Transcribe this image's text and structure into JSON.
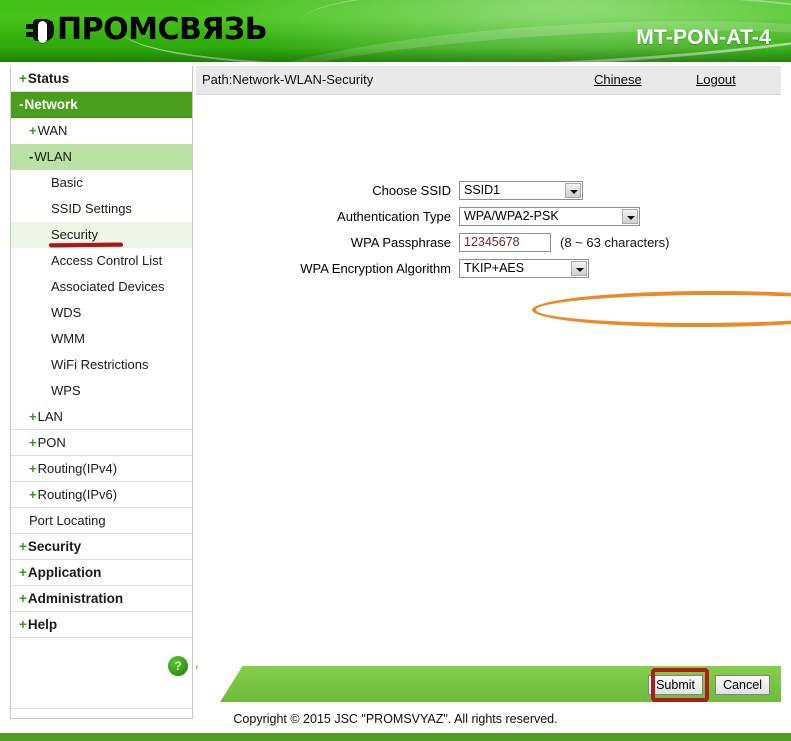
{
  "header": {
    "logo_text": "ПРОМСВЯЗЬ",
    "logo_icon": "plug-icon",
    "model": "MT-PON-AT-4",
    "brand_green": "#3fbf16"
  },
  "sidebar": {
    "items": [
      {
        "sign": "+",
        "label": "Status",
        "level": "top",
        "state": "normal"
      },
      {
        "sign": "-",
        "label": "Network",
        "level": "top",
        "state": "active-dark"
      },
      {
        "sign": "+",
        "label": "WAN",
        "level": "lvl2",
        "state": "normal"
      },
      {
        "sign": "-",
        "label": "WLAN",
        "level": "lvl2",
        "state": "active-mid"
      },
      {
        "sign": "",
        "label": "Basic",
        "level": "lvl3",
        "state": "normal"
      },
      {
        "sign": "",
        "label": "SSID Settings",
        "level": "lvl3",
        "state": "normal"
      },
      {
        "sign": "",
        "label": "Security",
        "level": "lvl3",
        "state": "active-pale"
      },
      {
        "sign": "",
        "label": "Access Control List",
        "level": "lvl3",
        "state": "normal"
      },
      {
        "sign": "",
        "label": "Associated Devices",
        "level": "lvl3",
        "state": "normal"
      },
      {
        "sign": "",
        "label": "WDS",
        "level": "lvl3",
        "state": "normal"
      },
      {
        "sign": "",
        "label": "WMM",
        "level": "lvl3",
        "state": "normal"
      },
      {
        "sign": "",
        "label": "WiFi Restrictions",
        "level": "lvl3",
        "state": "normal"
      },
      {
        "sign": "",
        "label": "WPS",
        "level": "lvl3",
        "state": "normal"
      },
      {
        "sign": "+",
        "label": "LAN",
        "level": "lvl2",
        "state": "sep"
      },
      {
        "sign": "+",
        "label": "PON",
        "level": "lvl2",
        "state": "sep"
      },
      {
        "sign": "+",
        "label": "Routing(IPv4)",
        "level": "lvl2",
        "state": "sep"
      },
      {
        "sign": "+",
        "label": "Routing(IPv6)",
        "level": "lvl2",
        "state": "sep"
      },
      {
        "sign": "",
        "label": "Port Locating",
        "level": "lvl2",
        "state": "sep"
      },
      {
        "sign": "+",
        "label": "Security",
        "level": "top",
        "state": "sep"
      },
      {
        "sign": "+",
        "label": "Application",
        "level": "top",
        "state": "sep"
      },
      {
        "sign": "+",
        "label": "Administration",
        "level": "top",
        "state": "sep"
      },
      {
        "sign": "+",
        "label": "Help",
        "level": "top",
        "state": "sep"
      }
    ],
    "help_badge": "?",
    "annotation": {
      "type": "underline",
      "target": "Security",
      "color": "#a81818"
    }
  },
  "pathbar": {
    "path": "Path:Network-WLAN-Security",
    "language_link": "Chinese",
    "logout_link": "Logout"
  },
  "form": {
    "rows": [
      {
        "label": "Choose SSID",
        "control": "select",
        "value": "SSID1"
      },
      {
        "label": "Authentication Type",
        "control": "select",
        "value": "WPA/WPA2-PSK"
      },
      {
        "label": "WPA Passphrase",
        "control": "text",
        "value": "12345678",
        "hint": "(8 ~ 63 characters)"
      },
      {
        "label": "WPA Encryption Algorithm",
        "control": "select",
        "value": "TKIP+AES"
      }
    ],
    "annotation": {
      "type": "ellipse",
      "target": "WPA Passphrase",
      "color": "#e98a2b"
    }
  },
  "footer": {
    "submit_label": "Submit",
    "cancel_label": "Cancel",
    "copyright": "Copyright © 2015 JSC \"PROMSVYAZ\". All rights reserved.",
    "annotation": {
      "type": "rectangle",
      "target": "Submit",
      "color": "#b01b1b"
    }
  }
}
